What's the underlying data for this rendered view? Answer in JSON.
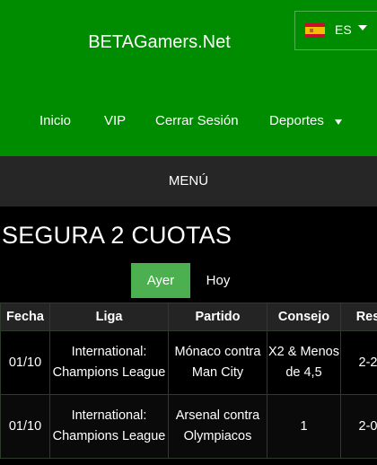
{
  "header": {
    "brand": "BETAGamers.Net",
    "language": {
      "code": "ES",
      "flag_icon": "spain-flag-icon"
    },
    "nav": {
      "inicio": "Inicio",
      "vip": "VIP",
      "cerrar_sesion": "Cerrar Sesión",
      "deportes": "Deportes"
    },
    "colors": {
      "header_bg": "#008c00",
      "active_button": "#4caf50"
    }
  },
  "menu": {
    "label": "MENÚ"
  },
  "main": {
    "title": "SEGURA 2 CUOTAS",
    "day_tabs": [
      {
        "label": "Ayer",
        "active": true
      },
      {
        "label": "Hoy",
        "active": false
      }
    ],
    "table": {
      "columns": [
        "Fecha",
        "Liga",
        "Partido",
        "Consejo",
        "Res"
      ],
      "rows": [
        {
          "fecha": "01/10",
          "liga": "International: Champions League",
          "partido": "Mónaco contra Man City",
          "consejo": "X2 & Menos de 4,5",
          "res": "2-2"
        },
        {
          "fecha": "01/10",
          "liga": "International: Champions League",
          "partido": "Arsenal contra Olympiacos",
          "consejo": "1",
          "res": "2-0"
        }
      ]
    }
  }
}
